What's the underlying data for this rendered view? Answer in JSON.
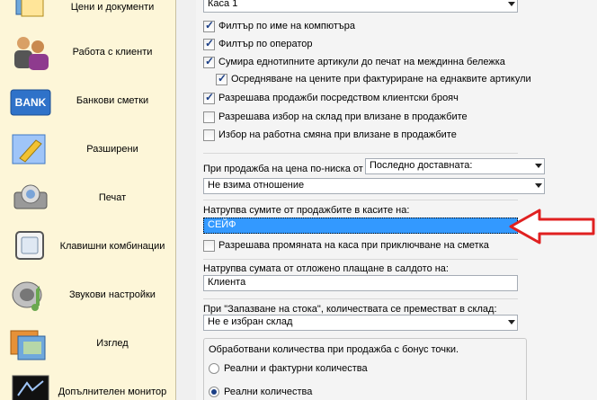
{
  "sidebar": {
    "items": [
      {
        "label": "Цени и документи",
        "icon": "prices-documents-icon"
      },
      {
        "label": "Работа с клиенти",
        "icon": "clients-icon"
      },
      {
        "label": "Банкови сметки",
        "icon": "bank-icon",
        "icon_text": "BANK"
      },
      {
        "label": "Разширени",
        "icon": "advanced-icon"
      },
      {
        "label": "Печат",
        "icon": "print-icon"
      },
      {
        "label": "Клавишни комбинации",
        "icon": "keyboard-shortcuts-icon"
      },
      {
        "label": "Звукови настройки",
        "icon": "sound-settings-icon"
      },
      {
        "label": "Изглед",
        "icon": "view-icon"
      },
      {
        "label": "Допълнителен монитор",
        "icon": "monitor-icon"
      }
    ]
  },
  "main": {
    "top_combo": "Каса 1",
    "checkboxes": [
      {
        "label": "Филтър по име на компютъра",
        "checked": true
      },
      {
        "label": "Филтър по оператор",
        "checked": true
      },
      {
        "label": "Сумира еднотипните артикули до печат на междинна бележка",
        "checked": true
      },
      {
        "label": "Осредняване на цените при фактуриране на еднаквите артикули",
        "checked": true
      },
      {
        "label": "Разрешава продажби посредством клиентски брояч",
        "checked": true
      },
      {
        "label": "Разрешава избор на склад при влизане в продажбите",
        "checked": false
      },
      {
        "label": "Избор на работна смяна при влизане в продажбите",
        "checked": false
      }
    ],
    "lower_price_label": "При продажба на цена по-ниска от",
    "lower_price_combo": "Последно доставната:",
    "lower_price_action_combo": "Не взима отношение",
    "accumulate_label": "Натрупва сумите от продажбите в касите на:",
    "accumulate_combo": "СЕЙФ",
    "allow_change_checkbox": {
      "label": "Разрешава промяната на каса при приключване на сметка",
      "checked": false
    },
    "deferred_label": "Натрупва сумата от отложено плащане в салдото на:",
    "deferred_combo": "Клиента",
    "save_goods_label": "При \"Запазване на стока\", количествата се преместват в склад:",
    "save_goods_combo": "Не е избран склад",
    "bonus_group_title": "Обработвани количества при продажба с бонус точки.",
    "bonus_radios": [
      {
        "label": "Реални и фактурни количества",
        "checked": false
      },
      {
        "label": "Реални количества",
        "checked": true
      }
    ]
  },
  "colors": {
    "sidebar_bg": "#fdf6d8",
    "selection": "#3399ff",
    "arrow": "#e02020"
  }
}
